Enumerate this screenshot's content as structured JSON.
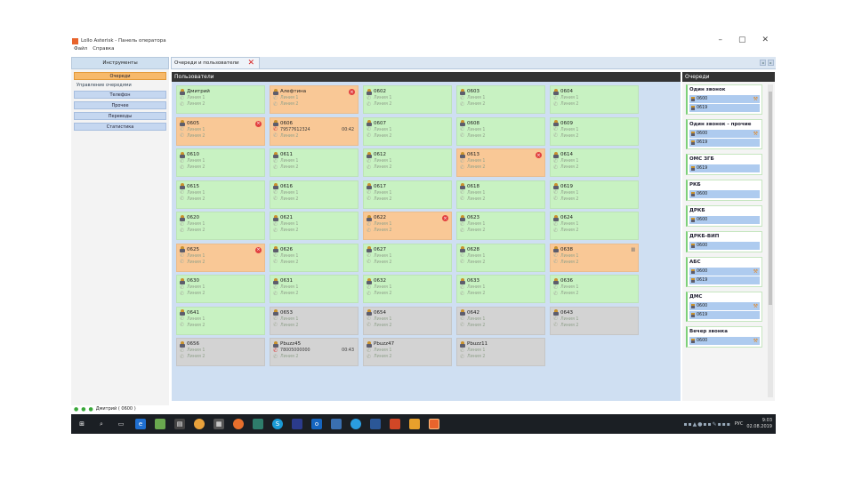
{
  "window": {
    "title": "Lollo Asterisk - Панель оператора",
    "menu": [
      "Файл",
      "Справка"
    ],
    "controls": [
      "–",
      "▢",
      "✕"
    ]
  },
  "left_panel": {
    "header": "Инструменты",
    "buttons": [
      {
        "label": "Очереди",
        "active": true
      },
      {
        "label": "Управление очередями",
        "link": true
      },
      {
        "label": "Телефон"
      },
      {
        "label": "Прочее"
      },
      {
        "label": "Переводы"
      },
      {
        "label": "Статистика"
      }
    ]
  },
  "tabs": {
    "active_tab": "Очереди и пользователи",
    "close_glyph": "✕",
    "nav": [
      "◂",
      "▸"
    ]
  },
  "users_panel": {
    "header": "Пользователи",
    "cards": [
      {
        "name": "Дмитрий",
        "status": "green",
        "lines": [
          "Линия 1",
          "Линия 2"
        ]
      },
      {
        "name": "Алефтина",
        "status": "orange",
        "badge": "x",
        "lines": [
          "Линия 1",
          "Линия 2"
        ]
      },
      {
        "name": "0602",
        "status": "green",
        "lines": [
          "Линия 1",
          "Линия 2"
        ]
      },
      {
        "name": "0603",
        "status": "green",
        "lines": [
          "Линия 1",
          "Линия 2"
        ]
      },
      {
        "name": "0604",
        "status": "green",
        "lines": [
          "Линия 1",
          "Линия 2"
        ]
      },
      {
        "name": "0605",
        "status": "orange",
        "badge": "x",
        "lines": [
          "Линия 1",
          "Линия 2"
        ]
      },
      {
        "name": "0606",
        "status": "orange",
        "call": "79577612324",
        "timer": "00:42",
        "lines": [
          "Линия 2"
        ]
      },
      {
        "name": "0607",
        "status": "green",
        "lines": [
          "Линия 1",
          "Линия 2"
        ]
      },
      {
        "name": "0608",
        "status": "green",
        "lines": [
          "Линия 1",
          "Линия 2"
        ]
      },
      {
        "name": "0609",
        "status": "green",
        "lines": [
          "Линия 1",
          "Линия 2"
        ]
      },
      {
        "name": "0610",
        "status": "green",
        "lines": [
          "Линия 1",
          "Линия 2"
        ]
      },
      {
        "name": "0611",
        "status": "green",
        "lines": [
          "Линия 1",
          "Линия 2"
        ]
      },
      {
        "name": "0612",
        "status": "green",
        "lines": [
          "Линия 1",
          "Линия 2"
        ]
      },
      {
        "name": "0613",
        "status": "orange",
        "badge": "x",
        "lines": [
          "Линия 1",
          "Линия 2"
        ]
      },
      {
        "name": "0614",
        "status": "green",
        "lines": [
          "Линия 1",
          "Линия 2"
        ]
      },
      {
        "name": "0615",
        "status": "green",
        "lines": [
          "Линия 1",
          "Линия 2"
        ]
      },
      {
        "name": "0616",
        "status": "green",
        "lines": [
          "Линия 1",
          "Линия 2"
        ]
      },
      {
        "name": "0617",
        "status": "green",
        "lines": [
          "Линия 1",
          "Линия 2"
        ]
      },
      {
        "name": "0618",
        "status": "green",
        "lines": [
          "Линия 1",
          "Линия 2"
        ]
      },
      {
        "name": "0619",
        "status": "green",
        "lines": [
          "Линия 1",
          "Линия 2"
        ]
      },
      {
        "name": "0620",
        "status": "green",
        "lines": [
          "Линия 1",
          "Линия 2"
        ]
      },
      {
        "name": "0621",
        "status": "green",
        "lines": [
          "Линия 1",
          "Линия 2"
        ]
      },
      {
        "name": "0622",
        "status": "orange",
        "badge": "x",
        "lines": [
          "Линия 1",
          "Линия 2"
        ]
      },
      {
        "name": "0623",
        "status": "green",
        "lines": [
          "Линия 1",
          "Линия 2"
        ]
      },
      {
        "name": "0624",
        "status": "green",
        "lines": [
          "Линия 1",
          "Линия 2"
        ]
      },
      {
        "name": "0625",
        "status": "orange",
        "badge": "x",
        "lines": [
          "Линия 1",
          "Линия 2"
        ]
      },
      {
        "name": "0626",
        "status": "green",
        "lines": [
          "Линия 1",
          "Линия 2"
        ]
      },
      {
        "name": "0627",
        "status": "green",
        "lines": [
          "Линия 1",
          "Линия 2"
        ]
      },
      {
        "name": "0628",
        "status": "green",
        "lines": [
          "Линия 1",
          "Линия 2"
        ]
      },
      {
        "name": "0638",
        "status": "orange",
        "pause": "II",
        "lines": [
          "Линия 1",
          "Линия 2"
        ]
      },
      {
        "name": "0630",
        "status": "green",
        "lines": [
          "Линия 1",
          "Линия 2"
        ]
      },
      {
        "name": "0631",
        "status": "green",
        "lines": [
          "Линия 1",
          "Линия 2"
        ]
      },
      {
        "name": "0632",
        "status": "green",
        "lines": [
          "Линия 1",
          "Линия 2"
        ]
      },
      {
        "name": "0633",
        "status": "green",
        "lines": [
          "Линия 1",
          "Линия 2"
        ]
      },
      {
        "name": "0636",
        "status": "green",
        "lines": [
          "Линия 1",
          "Линия 2"
        ]
      },
      {
        "name": "0641",
        "status": "green",
        "lines": [
          "Линия 1",
          "Линия 2"
        ]
      },
      {
        "name": "0653",
        "status": "gray",
        "lines": [
          "Линия 1",
          "Линия 2"
        ]
      },
      {
        "name": "0654",
        "status": "gray",
        "lines": [
          "Линия 1",
          "Линия 2"
        ]
      },
      {
        "name": "0642",
        "status": "gray",
        "lines": [
          "Линия 1",
          "Линия 2"
        ]
      },
      {
        "name": "0643",
        "status": "gray",
        "lines": [
          "Линия 1",
          "Линия 2"
        ]
      },
      {
        "name": "0656",
        "status": "gray",
        "lines": [
          "Линия 1",
          "Линия 2"
        ]
      },
      {
        "name": "Pbuzz45",
        "status": "gray",
        "call": "78005000000",
        "timer": "00:43",
        "lines": [
          "Линия 2"
        ]
      },
      {
        "name": "Pbuzz47",
        "status": "gray",
        "lines": [
          "Линия 1",
          "Линия 2"
        ]
      },
      {
        "name": "Pbuzz11",
        "status": "gray",
        "lines": [
          "Линия 1",
          "Линия 2"
        ]
      }
    ]
  },
  "queues_panel": {
    "header": "Очереди",
    "queues": [
      {
        "title": "Один звонок",
        "items": [
          {
            "label": "0600",
            "wrench": true
          },
          {
            "label": "0619"
          }
        ]
      },
      {
        "title": "Один звонок - прочие",
        "items": [
          {
            "label": "0600",
            "wrench": true
          },
          {
            "label": "0619"
          }
        ]
      },
      {
        "title": "ОМС ЗГБ",
        "items": [
          {
            "label": "0619"
          }
        ]
      },
      {
        "title": "РКБ",
        "items": [
          {
            "label": "0600"
          }
        ]
      },
      {
        "title": "ДРКБ",
        "items": [
          {
            "label": "0600"
          }
        ]
      },
      {
        "title": "ДРКБ-ВИП",
        "items": [
          {
            "label": "0600"
          }
        ]
      },
      {
        "title": "АБС",
        "items": [
          {
            "label": "0600",
            "wrench": true
          },
          {
            "label": "0619"
          }
        ]
      },
      {
        "title": "ДМС",
        "items": [
          {
            "label": "0600",
            "wrench": true
          },
          {
            "label": "0619"
          }
        ]
      },
      {
        "title": "Вечер звонка",
        "items": [
          {
            "label": "0600",
            "wrench": true
          }
        ]
      }
    ]
  },
  "status_bar": {
    "text": "Дмитрий  ( 0600 )"
  },
  "taskbar": {
    "lang": "РУС",
    "time": "9:03",
    "date": "02.08.2019"
  },
  "colors": {
    "green_card": "#c8f2c2",
    "orange_card": "#f9c896",
    "gray_card": "#d3d3d3",
    "panel_bg": "#cfdff2",
    "header_dark": "#333333"
  }
}
